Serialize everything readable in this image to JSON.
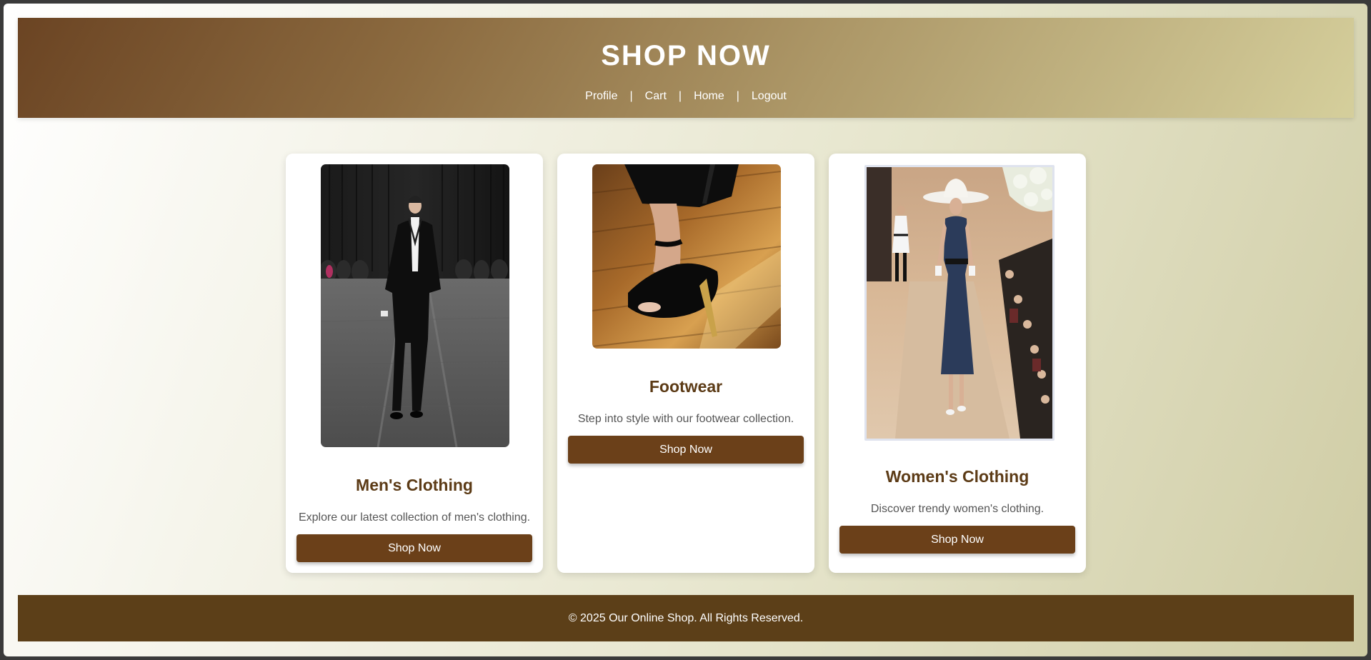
{
  "header": {
    "title": "SHOP NOW",
    "nav": [
      {
        "label": "Profile"
      },
      {
        "label": "Cart"
      },
      {
        "label": "Home"
      },
      {
        "label": "Logout"
      }
    ],
    "separator": "|"
  },
  "cards": [
    {
      "title": "Men's Clothing",
      "description": "Explore our latest collection of men's clothing.",
      "button_label": "Shop Now",
      "image": "runway-menswear-photo"
    },
    {
      "title": "Footwear",
      "description": "Step into style with our footwear collection.",
      "button_label": "Shop Now",
      "image": "stiletto-heels-photo"
    },
    {
      "title": "Women's Clothing",
      "description": "Discover trendy women's clothing.",
      "button_label": "Shop Now",
      "image": "runway-womenswear-photo"
    }
  ],
  "footer": {
    "text": "© 2025 Our Online Shop. All Rights Reserved."
  },
  "colors": {
    "header_start": "#6b4423",
    "header_end": "#d5cf9c",
    "heading_brown": "#5c3b16",
    "button_brown": "#6b4019",
    "footer_brown": "#5c3f18"
  }
}
